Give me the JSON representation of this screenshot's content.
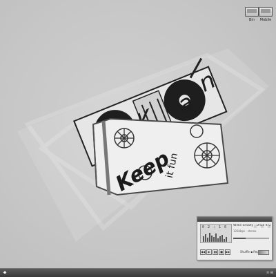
{
  "desktop_icons": [
    {
      "label": "Bin",
      "icon": "folder-window-icon"
    },
    {
      "label": "Mobile",
      "icon": "folder-window-icon"
    }
  ],
  "player": {
    "song": "Willie Snooty - Once It Up (Sho",
    "meta": "128kbps · stereo",
    "digits": "0 2 : 1 6",
    "mode_label": "Shuffle ▪ Repeat",
    "progress_fraction": 0.35,
    "controls": [
      "◀◀",
      "▶",
      "▮▮",
      "■",
      "▶▶"
    ]
  },
  "wallpaper": {
    "text": "Keep it fun",
    "accent": "#2b2b2b"
  },
  "taskbar": {
    "start_glyph": "◆",
    "tray_text": "≡ ⊞"
  }
}
